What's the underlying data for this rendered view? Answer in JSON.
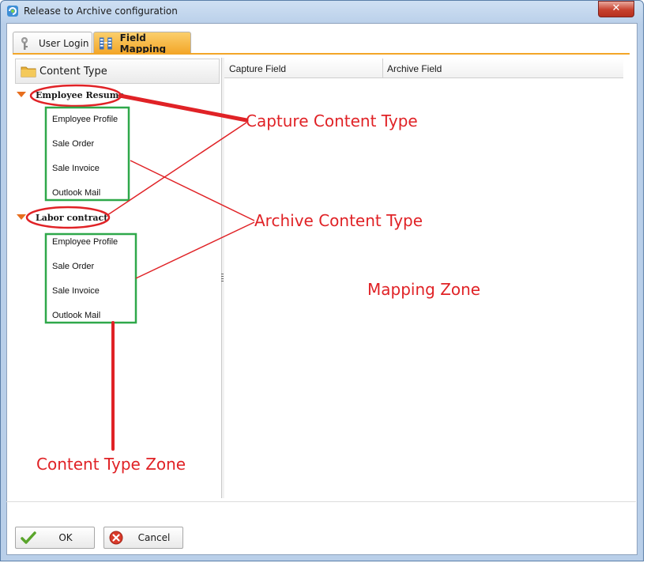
{
  "window": {
    "title": "Release to Archive configuration",
    "close_glyph": "✕"
  },
  "tabs": [
    {
      "label": "User Login",
      "icon": "keys-icon",
      "active": false
    },
    {
      "label": "Field Mapping",
      "icon": "field-mapping-icon",
      "active": true
    }
  ],
  "content_type_panel": {
    "header": "Content Type",
    "groups": [
      {
        "label": "Employee Resume",
        "children": [
          "Employee Profile",
          "Sale Order",
          "Sale Invoice",
          "Outlook Mail"
        ]
      },
      {
        "label": "Labor contract",
        "children": [
          "Employee Profile",
          "Sale Order",
          "Sale Invoice",
          "Outlook Mail"
        ]
      }
    ]
  },
  "mapping_grid": {
    "columns": [
      "Capture Field",
      "Archive Field"
    ]
  },
  "buttons": {
    "ok": "OK",
    "cancel": "Cancel"
  },
  "annotations": {
    "capture_content_type": "Capture Content Type",
    "archive_content_type": "Archive Content Type",
    "mapping_zone": "Mapping Zone",
    "content_type_zone": "Content Type Zone"
  },
  "colors": {
    "annotation_red": "#e02226",
    "annotation_green": "#2fa84a",
    "active_tab": "#f3a628",
    "tree_arrow": "#e76e1e"
  }
}
